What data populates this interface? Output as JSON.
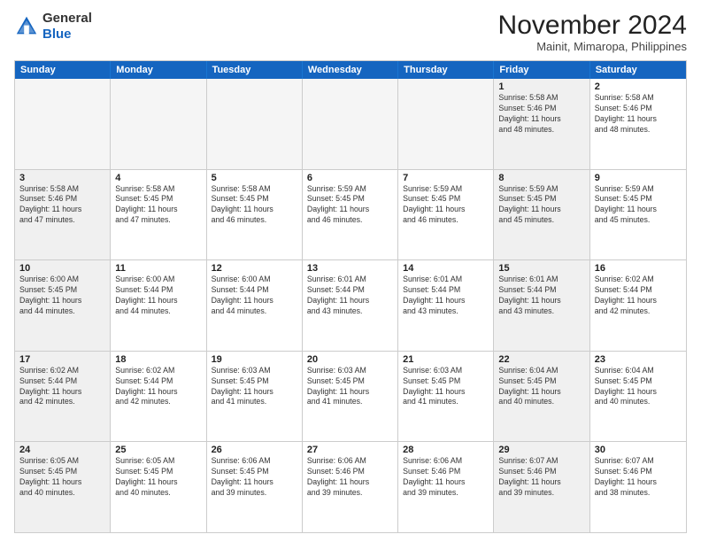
{
  "logo": {
    "general": "General",
    "blue": "Blue"
  },
  "title": "November 2024",
  "location": "Mainit, Mimaropa, Philippines",
  "header_days": [
    "Sunday",
    "Monday",
    "Tuesday",
    "Wednesday",
    "Thursday",
    "Friday",
    "Saturday"
  ],
  "weeks": [
    [
      {
        "day": "",
        "info": "",
        "empty": true
      },
      {
        "day": "",
        "info": "",
        "empty": true
      },
      {
        "day": "",
        "info": "",
        "empty": true
      },
      {
        "day": "",
        "info": "",
        "empty": true
      },
      {
        "day": "",
        "info": "",
        "empty": true
      },
      {
        "day": "1",
        "info": "Sunrise: 5:58 AM\nSunset: 5:46 PM\nDaylight: 11 hours\nand 48 minutes.",
        "shaded": true
      },
      {
        "day": "2",
        "info": "Sunrise: 5:58 AM\nSunset: 5:46 PM\nDaylight: 11 hours\nand 48 minutes."
      }
    ],
    [
      {
        "day": "3",
        "info": "Sunrise: 5:58 AM\nSunset: 5:46 PM\nDaylight: 11 hours\nand 47 minutes.",
        "shaded": true
      },
      {
        "day": "4",
        "info": "Sunrise: 5:58 AM\nSunset: 5:45 PM\nDaylight: 11 hours\nand 47 minutes."
      },
      {
        "day": "5",
        "info": "Sunrise: 5:58 AM\nSunset: 5:45 PM\nDaylight: 11 hours\nand 46 minutes."
      },
      {
        "day": "6",
        "info": "Sunrise: 5:59 AM\nSunset: 5:45 PM\nDaylight: 11 hours\nand 46 minutes."
      },
      {
        "day": "7",
        "info": "Sunrise: 5:59 AM\nSunset: 5:45 PM\nDaylight: 11 hours\nand 46 minutes."
      },
      {
        "day": "8",
        "info": "Sunrise: 5:59 AM\nSunset: 5:45 PM\nDaylight: 11 hours\nand 45 minutes.",
        "shaded": true
      },
      {
        "day": "9",
        "info": "Sunrise: 5:59 AM\nSunset: 5:45 PM\nDaylight: 11 hours\nand 45 minutes."
      }
    ],
    [
      {
        "day": "10",
        "info": "Sunrise: 6:00 AM\nSunset: 5:45 PM\nDaylight: 11 hours\nand 44 minutes.",
        "shaded": true
      },
      {
        "day": "11",
        "info": "Sunrise: 6:00 AM\nSunset: 5:44 PM\nDaylight: 11 hours\nand 44 minutes."
      },
      {
        "day": "12",
        "info": "Sunrise: 6:00 AM\nSunset: 5:44 PM\nDaylight: 11 hours\nand 44 minutes."
      },
      {
        "day": "13",
        "info": "Sunrise: 6:01 AM\nSunset: 5:44 PM\nDaylight: 11 hours\nand 43 minutes."
      },
      {
        "day": "14",
        "info": "Sunrise: 6:01 AM\nSunset: 5:44 PM\nDaylight: 11 hours\nand 43 minutes."
      },
      {
        "day": "15",
        "info": "Sunrise: 6:01 AM\nSunset: 5:44 PM\nDaylight: 11 hours\nand 43 minutes.",
        "shaded": true
      },
      {
        "day": "16",
        "info": "Sunrise: 6:02 AM\nSunset: 5:44 PM\nDaylight: 11 hours\nand 42 minutes."
      }
    ],
    [
      {
        "day": "17",
        "info": "Sunrise: 6:02 AM\nSunset: 5:44 PM\nDaylight: 11 hours\nand 42 minutes.",
        "shaded": true
      },
      {
        "day": "18",
        "info": "Sunrise: 6:02 AM\nSunset: 5:44 PM\nDaylight: 11 hours\nand 42 minutes."
      },
      {
        "day": "19",
        "info": "Sunrise: 6:03 AM\nSunset: 5:45 PM\nDaylight: 11 hours\nand 41 minutes."
      },
      {
        "day": "20",
        "info": "Sunrise: 6:03 AM\nSunset: 5:45 PM\nDaylight: 11 hours\nand 41 minutes."
      },
      {
        "day": "21",
        "info": "Sunrise: 6:03 AM\nSunset: 5:45 PM\nDaylight: 11 hours\nand 41 minutes."
      },
      {
        "day": "22",
        "info": "Sunrise: 6:04 AM\nSunset: 5:45 PM\nDaylight: 11 hours\nand 40 minutes.",
        "shaded": true
      },
      {
        "day": "23",
        "info": "Sunrise: 6:04 AM\nSunset: 5:45 PM\nDaylight: 11 hours\nand 40 minutes."
      }
    ],
    [
      {
        "day": "24",
        "info": "Sunrise: 6:05 AM\nSunset: 5:45 PM\nDaylight: 11 hours\nand 40 minutes.",
        "shaded": true
      },
      {
        "day": "25",
        "info": "Sunrise: 6:05 AM\nSunset: 5:45 PM\nDaylight: 11 hours\nand 40 minutes."
      },
      {
        "day": "26",
        "info": "Sunrise: 6:06 AM\nSunset: 5:45 PM\nDaylight: 11 hours\nand 39 minutes."
      },
      {
        "day": "27",
        "info": "Sunrise: 6:06 AM\nSunset: 5:46 PM\nDaylight: 11 hours\nand 39 minutes."
      },
      {
        "day": "28",
        "info": "Sunrise: 6:06 AM\nSunset: 5:46 PM\nDaylight: 11 hours\nand 39 minutes."
      },
      {
        "day": "29",
        "info": "Sunrise: 6:07 AM\nSunset: 5:46 PM\nDaylight: 11 hours\nand 39 minutes.",
        "shaded": true
      },
      {
        "day": "30",
        "info": "Sunrise: 6:07 AM\nSunset: 5:46 PM\nDaylight: 11 hours\nand 38 minutes."
      }
    ]
  ]
}
